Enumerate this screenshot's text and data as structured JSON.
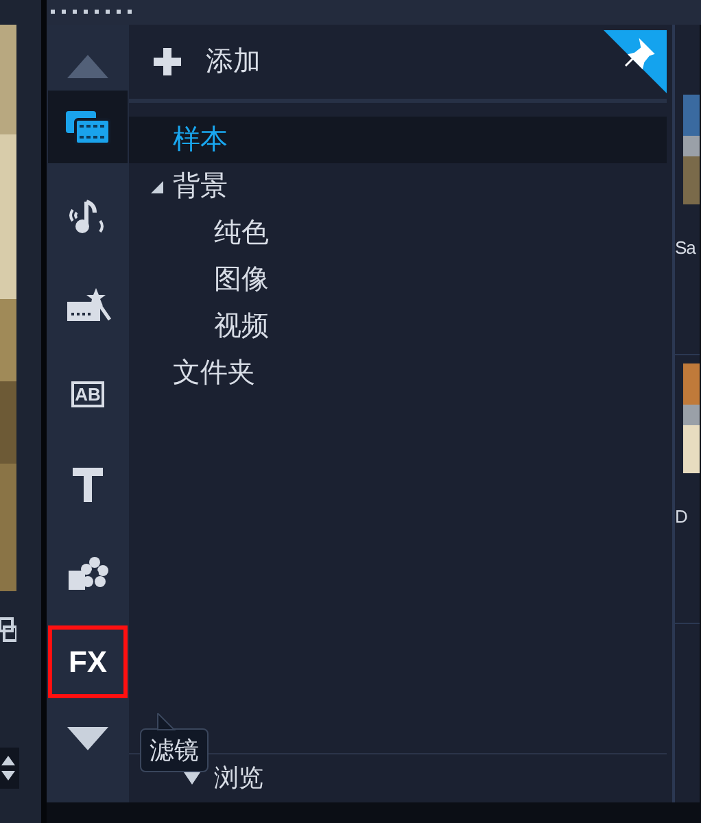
{
  "library_panel": {
    "add_button": {
      "label": "添加"
    },
    "tree": [
      {
        "label": "样本",
        "selected": true
      },
      {
        "label": "背景",
        "selected": false,
        "expanded": true,
        "children": [
          {
            "label": "纯色",
            "selected": false
          },
          {
            "label": "图像",
            "selected": false
          },
          {
            "label": "视频",
            "selected": false
          }
        ]
      },
      {
        "label": "文件夹",
        "selected": false
      }
    ],
    "browse_button": {
      "label": "浏览"
    }
  },
  "toolbar": {
    "tools": [
      {
        "kind": "media",
        "selected": true
      },
      {
        "kind": "audio",
        "selected": false
      },
      {
        "kind": "instant",
        "selected": false
      },
      {
        "kind": "title",
        "label": "AB",
        "selected": false
      },
      {
        "kind": "text",
        "selected": false
      },
      {
        "kind": "graphics",
        "selected": false
      },
      {
        "kind": "fx",
        "label": "FX",
        "selected": false,
        "outlined": true
      }
    ],
    "tooltip": "滤镜"
  },
  "right_strip": {
    "captions": [
      "Sa",
      "D"
    ]
  }
}
